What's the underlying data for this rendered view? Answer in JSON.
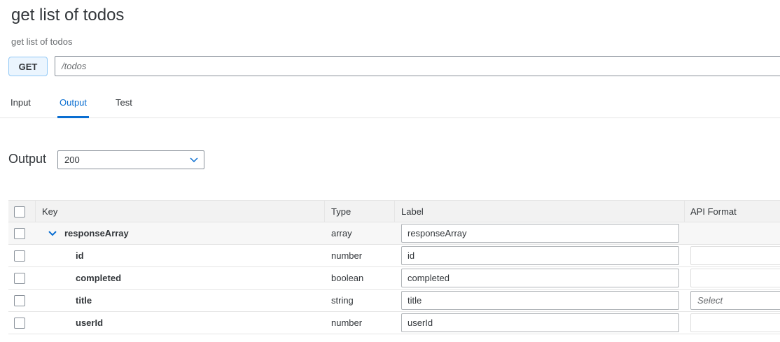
{
  "page": {
    "title": "get list of todos",
    "subtitle": "get list of todos"
  },
  "request": {
    "method": "GET",
    "path": "/todos"
  },
  "tabs": [
    {
      "label": "Input",
      "active": false
    },
    {
      "label": "Output",
      "active": true
    },
    {
      "label": "Test",
      "active": false
    }
  ],
  "output": {
    "label": "Output",
    "status_selected": "200"
  },
  "table": {
    "columns": [
      "Key",
      "Type",
      "Label",
      "API Format"
    ],
    "rows": [
      {
        "key": "responseArray",
        "type": "array",
        "label": "responseArray",
        "api_format": "",
        "expandable": true
      },
      {
        "key": "id",
        "type": "number",
        "label": "id",
        "api_format": ""
      },
      {
        "key": "completed",
        "type": "boolean",
        "label": "completed",
        "api_format": ""
      },
      {
        "key": "title",
        "type": "string",
        "label": "title",
        "api_format_placeholder": "Select"
      },
      {
        "key": "userId",
        "type": "number",
        "label": "userId",
        "api_format": ""
      }
    ]
  },
  "colors": {
    "accent": "#0a6ed1",
    "text": "#32363a",
    "badge_bg": "#ebf5fe",
    "badge_border": "#91c8f6",
    "header_bg": "#f2f2f2"
  },
  "icons": {
    "select_chevron": "chevron-down-icon",
    "row_expand": "chevron-down-icon"
  }
}
